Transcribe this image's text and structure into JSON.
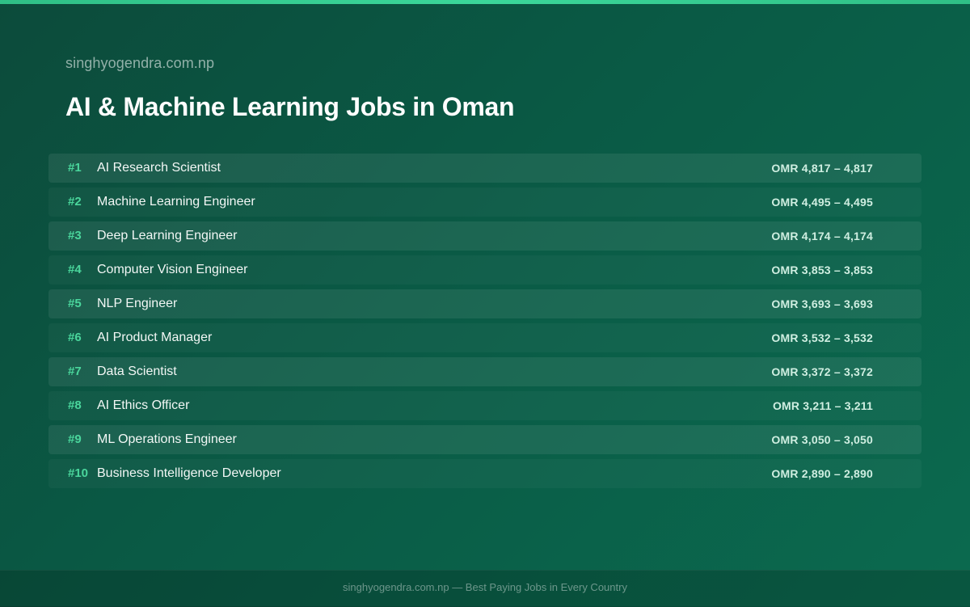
{
  "header": {
    "site": "singhyogendra.com.np",
    "title": "AI & Machine Learning Jobs in Oman"
  },
  "jobs": [
    {
      "rank": "#1",
      "title": "AI Research Scientist",
      "salary": "OMR 4,817 – 4,817"
    },
    {
      "rank": "#2",
      "title": "Machine Learning Engineer",
      "salary": "OMR 4,495 – 4,495"
    },
    {
      "rank": "#3",
      "title": "Deep Learning Engineer",
      "salary": "OMR 4,174 – 4,174"
    },
    {
      "rank": "#4",
      "title": "Computer Vision Engineer",
      "salary": "OMR 3,853 – 3,853"
    },
    {
      "rank": "#5",
      "title": "NLP Engineer",
      "salary": "OMR 3,693 – 3,693"
    },
    {
      "rank": "#6",
      "title": "AI Product Manager",
      "salary": "OMR 3,532 – 3,532"
    },
    {
      "rank": "#7",
      "title": "Data Scientist",
      "salary": "OMR 3,372 – 3,372"
    },
    {
      "rank": "#8",
      "title": "AI Ethics Officer",
      "salary": "OMR 3,211 – 3,211"
    },
    {
      "rank": "#9",
      "title": "ML Operations Engineer",
      "salary": "OMR 3,050 – 3,050"
    },
    {
      "rank": "#10",
      "title": "Business Intelligence Developer",
      "salary": "OMR 2,890 – 2,890"
    }
  ],
  "footer": {
    "text": "singhyogendra.com.np — Best Paying Jobs in Every Country"
  },
  "colors": {
    "accent": "#3bd79a",
    "rank": "#4ad69c",
    "background": "#0a5a45"
  }
}
